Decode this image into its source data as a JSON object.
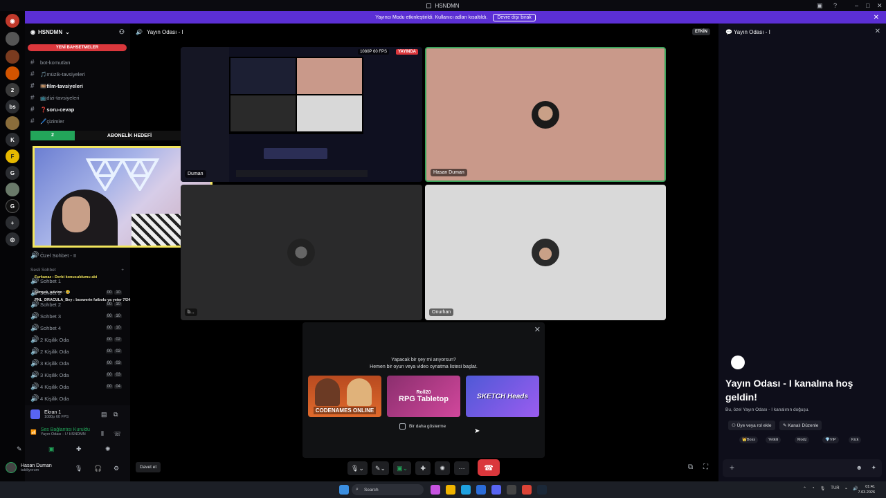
{
  "window": {
    "title": "HSNDMN"
  },
  "notice": {
    "text": "Yayıncı Modu etkinleştirildi. Kullanıcı adları kısaltıldı.",
    "button": "Devre dışı bırak"
  },
  "rail": {
    "badge": "2",
    "letters": [
      "bs",
      "K",
      "G"
    ]
  },
  "sidebar": {
    "server_name": "HSNDMN",
    "new_mentions": "YENİ BAHSETMELER",
    "channels": [
      {
        "label": "bot-komutları"
      },
      {
        "label": "🎵müzik-tavsiyeleri"
      },
      {
        "label": "🎞️film-tavsiyeleri"
      },
      {
        "label": "📺dizi-tavsiyeleri"
      },
      {
        "label": "❓soru-cevap"
      },
      {
        "label": "🖊️çizimler"
      }
    ],
    "private_voice": "Özel Sohbet - II",
    "voice_category": "Sesli Sohbet",
    "voice_channels": [
      {
        "label": "Sohbet 1",
        "a": "00",
        "b": "10"
      },
      {
        "label": "Sohbet 2",
        "a": "00",
        "b": "10"
      },
      {
        "label": "Sohbet 3",
        "a": "00",
        "b": "10"
      },
      {
        "label": "Sohbet 4",
        "a": "00",
        "b": "10"
      },
      {
        "label": "2 Kişilik Oda",
        "a": "00",
        "b": "02"
      },
      {
        "label": "2 Kişilik Oda",
        "a": "00",
        "b": "02"
      },
      {
        "label": "3 Kişilik Oda",
        "a": "00",
        "b": "03"
      },
      {
        "label": "3 Kişilik Oda",
        "a": "00",
        "b": "03"
      },
      {
        "label": "4 Kişilik Oda",
        "a": "00",
        "b": "04"
      },
      {
        "label": "4 Kişilik Oda",
        "a": "00",
        "b": "04"
      }
    ]
  },
  "overlay": {
    "goal_count": "2",
    "goal_label": "ABONELİK HEDEFİ",
    "goal_target": "10",
    "chat": [
      "Furkanaz : Derbi konusuldumu abi",
      "Şimşek_advioo : 😂",
      "PNL_DRACULA_Bey : boswerin futbolu ya yeter 7/24"
    ]
  },
  "voice_status": {
    "screen_label": "Ekran 1",
    "screen_sub": "1080p 60 FPS",
    "connection": "Ses Bağlantısı Kuruldu",
    "connection_sub": "Yayın Odası - I / HSNDMN",
    "user_name": "Hasan Duman",
    "user_status": "takiliyorum"
  },
  "main": {
    "channel_title": "Yayın Odası - I",
    "active_badge": "ETKİN",
    "stream_quality": "1080P 60 FPS",
    "live_label": "YAYINDA",
    "tiles": [
      {
        "name": "Duman"
      },
      {
        "name": "Hasan Duman"
      },
      {
        "name": "b..."
      },
      {
        "name": "Onurhan"
      }
    ]
  },
  "activity": {
    "question": "Yapacak bir şey mi arıyorsun?",
    "hint": "Hemen bir oyun veya video oynatma listesi başlat.",
    "games": [
      "CODENAMES ONLINE",
      "RPG Tabletop",
      "SKETCH Heads"
    ],
    "roll20": "Roll20",
    "dont_show": "Bir daha gösterme"
  },
  "controls": {
    "invite": "Davet et"
  },
  "chat_panel": {
    "title": "Yayın Odası - I",
    "welcome": "Yayın Odası - I kanalına hoş geldin!",
    "subtitle": "Bu, özel Yayın Odası - I kanalının doğuşu.",
    "add_role": "Üye veya rol ekle",
    "edit_channel": "Kanalı Düzenle",
    "roles": [
      "👑Boss",
      "Yetkili",
      "Modz",
      "💎VIP",
      "Kick"
    ]
  },
  "taskbar": {
    "search": "Search",
    "lang": "TUR",
    "time": "01:41",
    "date": "7.03.2026"
  },
  "colors": {
    "accent": "#5b2fd4",
    "danger": "#da373c",
    "online": "#23a55a",
    "highlight": "#f2e55c"
  }
}
